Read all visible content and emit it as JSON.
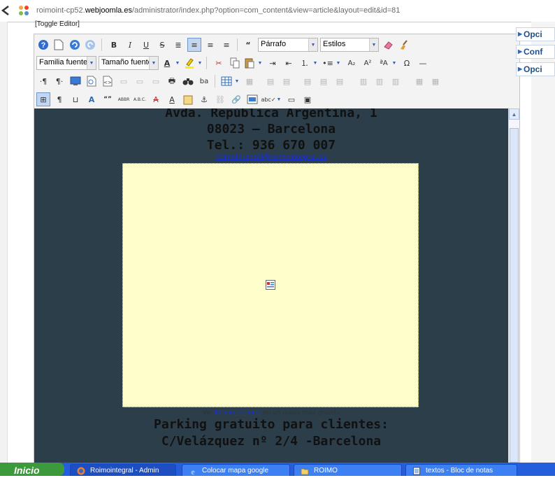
{
  "browser": {
    "url_prefix": "roimoint-cp52.",
    "url_domain": "webjoomla.es",
    "url_path": "/administrator/index.php?option=com_content&view=article&layout=edit&id=81"
  },
  "editor": {
    "toggle_label": "[Toggle Editor]",
    "format_value": "Párrafo",
    "styles_value": "Estilos",
    "font_family_value": "Familia fuente",
    "font_size_value": "Tamaño fuente"
  },
  "content": {
    "line_address": "Avda. República Argentina, 1",
    "line_city": "08023 – Barcelona",
    "line_phone": "Tel.: 936 670 007",
    "email": "roimointegral@roimointegral.es",
    "map_caption_pre": "Ver ",
    "map_caption_link": "Roimo Integral",
    "map_caption_post": " en un mapa más grande",
    "parking_line1": "Parking gratuito para clientes:",
    "parking_line2": "C/Velázquez nº 2/4 -Barcelona"
  },
  "right_panels": [
    "Opci",
    "Conf",
    "Opci"
  ],
  "taskbar": {
    "start_label": "Inicio",
    "tasks": [
      "Roimointegral - Admin",
      "Colocar mapa google",
      "ROIMO",
      "textos - Bloc de notas"
    ]
  },
  "colors": {
    "content_bg": "#2c3e4a",
    "map_bg": "#ffffcc",
    "taskbar": "#245edc",
    "start": "#3c9a3c"
  }
}
